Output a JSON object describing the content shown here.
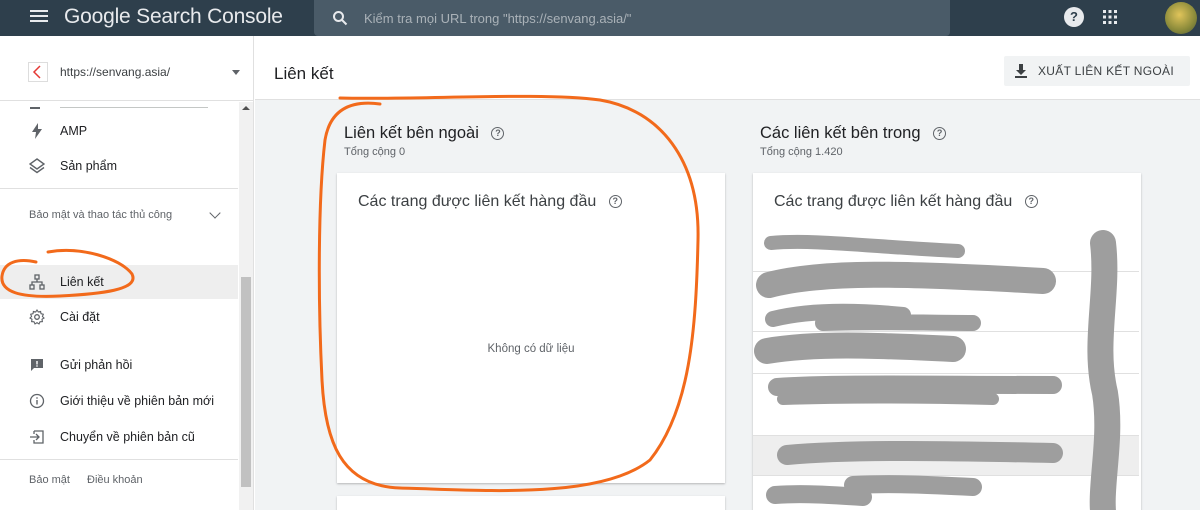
{
  "app": {
    "brand": "Google Search Console"
  },
  "search": {
    "placeholder": "Kiểm tra mọi URL trong \"https://senvang.asia/\""
  },
  "topbar": {
    "help": "?"
  },
  "property": {
    "url": "https://senvang.asia/"
  },
  "sidebar": {
    "items": [
      {
        "label": "AMP",
        "icon": "lightning-icon"
      },
      {
        "label": "Sản phẩm",
        "icon": "layers-icon"
      }
    ],
    "section_security": "Bảo mật và thao tác thủ công",
    "links_label": "Liên kết",
    "settings_label": "Cài đặt",
    "feedback_label": "Gửi phản hồi",
    "whats_new_label": "Giới thiệu về phiên bản mới",
    "old_version_label": "Chuyển về phiên bản cũ",
    "footer": {
      "privacy": "Bảo mật",
      "terms": "Điều khoản"
    }
  },
  "page": {
    "title": "Liên kết",
    "export_label": "XUẤT LIÊN KẾT NGOÀI"
  },
  "external": {
    "title": "Liên kết bên ngoài",
    "subtitle": "Tổng cộng 0",
    "card_title": "Các trang được liên kết hàng đầu",
    "no_data": "Không có dữ liệu"
  },
  "internal": {
    "title": "Các liên kết bên trong",
    "subtitle": "Tổng cộng 1.420",
    "card_title": "Các trang được liên kết hàng đầu"
  },
  "colors": {
    "topbar": "#2e3f4c",
    "annotation": "#f26a1b",
    "redaction": "#9e9e9e"
  }
}
